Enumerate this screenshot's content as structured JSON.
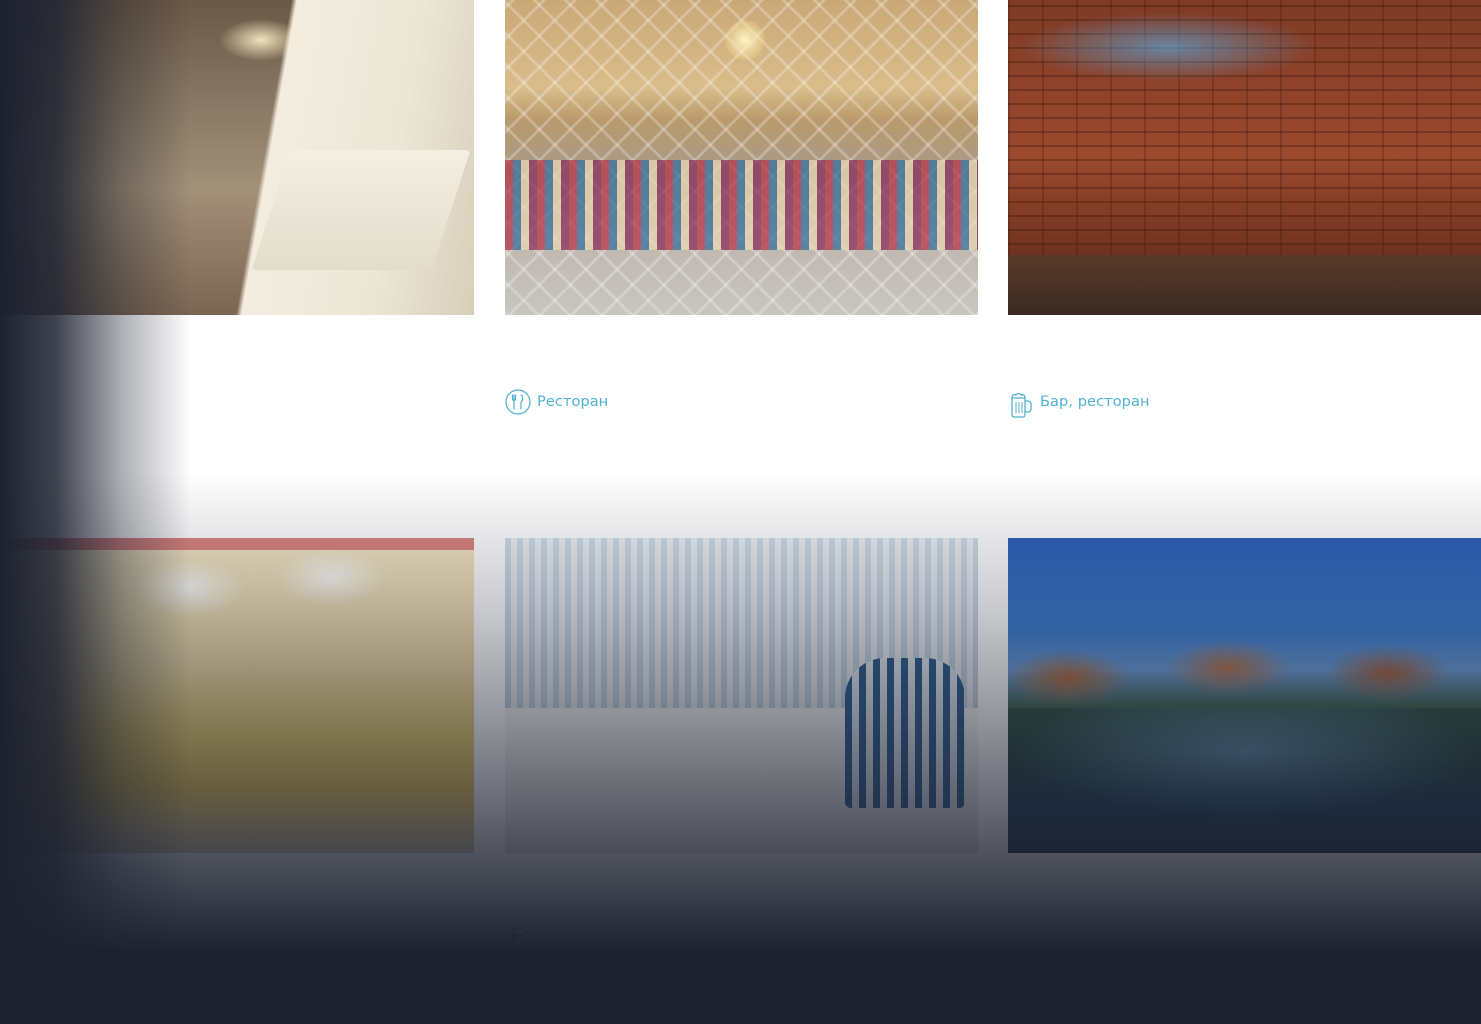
{
  "colors": {
    "accent": "#4fb2cf",
    "overlay": "#1d2230",
    "background": "#ffffff"
  },
  "cards": [
    {
      "image": "banquet-hall-photo",
      "type_label": "",
      "icon": ""
    },
    {
      "image": "restaurant-interior-photo",
      "type_label": "Ресторан",
      "icon": "fork-knife-icon"
    },
    {
      "image": "bar-stage-band-photo",
      "type_label": "Бар, ресторан",
      "icon": "beer-mug-icon"
    },
    {
      "image": "golden-banquet-hall-photo",
      "type_label": "",
      "icon": ""
    },
    {
      "image": "blue-chairs-dining-photo",
      "type_label": "",
      "icon": "fork-knife-icon"
    },
    {
      "image": "night-pond-complex-photo",
      "type_label": "",
      "icon": "beer-mug-icon"
    }
  ]
}
